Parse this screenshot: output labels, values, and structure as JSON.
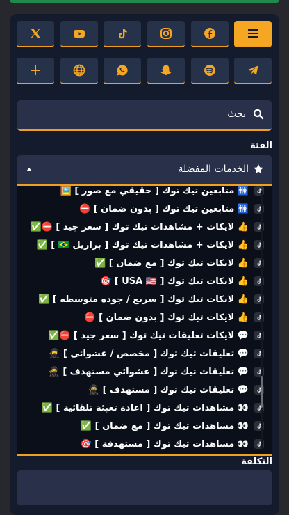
{
  "social_icons": {
    "row1": [
      "menu-icon",
      "facebook-icon",
      "instagram-icon",
      "tiktok-icon",
      "youtube-icon",
      "x-icon"
    ],
    "row2": [
      "telegram-icon",
      "spotify-icon",
      "snapchat-icon",
      "whatsapp-icon",
      "globe-icon",
      "plus-icon"
    ]
  },
  "colors": {
    "accent": "#f5a623",
    "panel": "#141b2d",
    "field": "#28304a"
  },
  "search": {
    "label": "بحث"
  },
  "category": {
    "label": "الفئة",
    "selected": "الخدمات المفضلة",
    "items": [
      "🚻 متابعين تيك توك [ حقيقي مع صور ] 🖼️",
      "🚻 متابعين تيك توك [ بدون ضمان ] ⛔",
      "👍 لايكات + مشاهدات تيك توك [ سعر جيد ] ⛔✅",
      "👍 لايكات + مشاهدات تيك توك [ برازيل 🇧🇷 ] ✅",
      "👍 لايكات تيك توك [ مع ضمان ] ✅",
      "👍 لايكات تيك توك [ USA 🇺🇸 ] 🎯",
      "👍 لايكات تيك توك [ سريع / جوده متوسطه ] ✅",
      "👍 لايكات تيك توك [ بدون ضمان ] ⛔",
      "💬 لايكات تعليقات تيك توك [ سعر جيد ] ⛔✅",
      "💬 تعليقات تيك توك [ مخصص / عشوائي ] 🥷",
      "💬 تعليقات تيك توك [ عشوائي مستهدف ] 🥷",
      "💬 تعليقات تيك توك [ مستهدف ] 🥷",
      "👀 مشاهدات تيك توك [ اعادة تعبئة تلقائية ] ✅",
      "👀 مشاهدات تيك توك [ مع ضمان ] ✅",
      "👀 مشاهدات تيك توك [ مستهدفة ] 🎯"
    ]
  },
  "cost": {
    "label": "التكلفة"
  }
}
